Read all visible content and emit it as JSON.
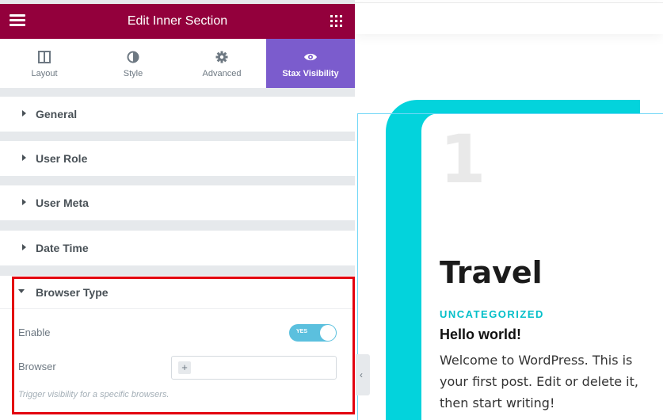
{
  "panel": {
    "title": "Edit Inner Section",
    "tabs": [
      {
        "label": "Layout",
        "icon": "columns-icon"
      },
      {
        "label": "Style",
        "icon": "half-circle-icon"
      },
      {
        "label": "Advanced",
        "icon": "gear-icon"
      },
      {
        "label": "Stax Visibility",
        "icon": "eye-icon",
        "active": true
      }
    ],
    "sections": [
      "General",
      "User Role",
      "User Meta",
      "Date Time"
    ],
    "browser": {
      "title": "Browser Type",
      "enable_label": "Enable",
      "enable_value": "YES",
      "browser_label": "Browser",
      "add_symbol": "+",
      "hint": "Trigger visibility for a specific browsers."
    },
    "colors": {
      "header": "#93003c",
      "active_tab": "#7b5ccd",
      "switch": "#5bc0de",
      "highlight": "#e3000f"
    }
  },
  "preview": {
    "number": "1",
    "category_title": "Travel",
    "category_tag": "UNCATEGORIZED",
    "post_title": "Hello world!",
    "excerpt": "Welcome to WordPress. This is your first post. Edit or delete it, then start writing!",
    "collapse_icon": "chevron-left-icon",
    "colors": {
      "accent": "#03d3dc"
    }
  }
}
